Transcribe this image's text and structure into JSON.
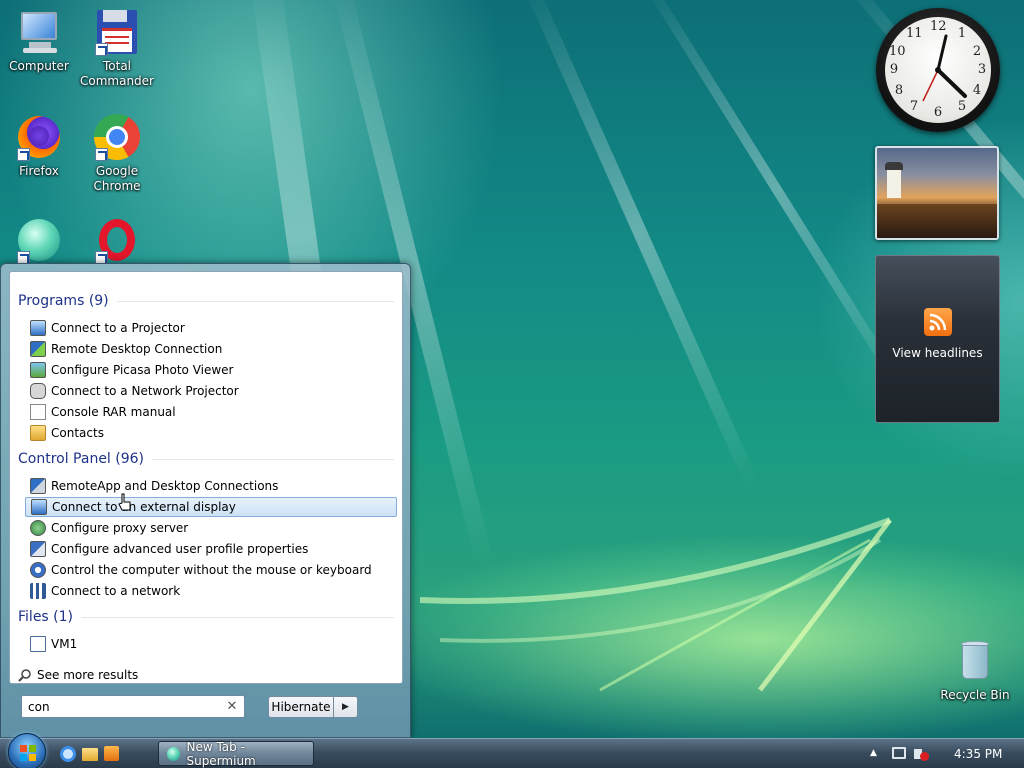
{
  "desktop": {
    "icons": [
      {
        "label": "Computer"
      },
      {
        "label": "Total Commander"
      },
      {
        "label": "Firefox"
      },
      {
        "label": "Google Chrome"
      },
      {
        "label": "Recycle Bin"
      }
    ]
  },
  "gadgets": {
    "clock_numbers": [
      "12",
      "1",
      "2",
      "3",
      "4",
      "5",
      "6",
      "7",
      "8",
      "9",
      "10",
      "11"
    ],
    "feed_label": "View headlines"
  },
  "start_menu": {
    "programs_header": "Programs (9)",
    "programs": [
      {
        "label": "Connect to a Projector",
        "icon": "projector-icon"
      },
      {
        "label": "Remote Desktop Connection",
        "icon": "remote-desktop-icon"
      },
      {
        "label": "Configure Picasa Photo Viewer",
        "icon": "picasa-icon"
      },
      {
        "label": "Connect to a Network Projector",
        "icon": "network-projector-icon"
      },
      {
        "label": "Console RAR manual",
        "icon": "document-icon"
      },
      {
        "label": "Contacts",
        "icon": "contacts-folder-icon"
      }
    ],
    "control_panel_header": "Control Panel (96)",
    "control_panel": [
      {
        "label": "RemoteApp and Desktop Connections",
        "icon": "remoteapp-icon"
      },
      {
        "label": "Connect to an external display",
        "icon": "display-icon"
      },
      {
        "label": "Configure proxy server",
        "icon": "proxy-icon"
      },
      {
        "label": "Configure advanced user profile properties",
        "icon": "user-profile-icon"
      },
      {
        "label": "Control the computer without the mouse or keyboard",
        "icon": "ease-of-access-icon"
      },
      {
        "label": "Connect to a network",
        "icon": "network-icon"
      }
    ],
    "files_header": "Files (1)",
    "files": [
      {
        "label": "VM1",
        "icon": "file-icon"
      }
    ],
    "see_more": "See more results",
    "search_value": "con",
    "hibernate_label": "Hibernate"
  },
  "taskbar": {
    "task_label": "New Tab - Supermium",
    "time": "4:35 PM"
  },
  "colors": {
    "selection_border": "#84acdd",
    "group_header": "#1e3287"
  }
}
